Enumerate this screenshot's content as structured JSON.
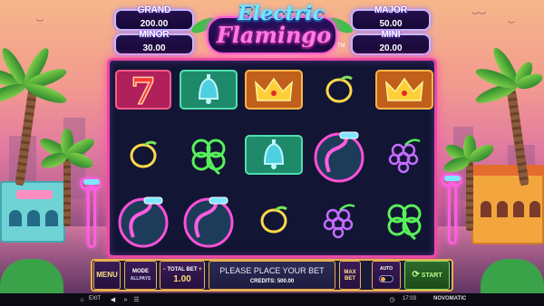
{
  "jackpots": {
    "grand": {
      "label": "GRAND",
      "value": "200.00"
    },
    "minor": {
      "label": "MINOR",
      "value": "30.00"
    },
    "major": {
      "label": "MAJOR",
      "value": "50.00"
    },
    "mini": {
      "label": "MINI",
      "value": "20.00"
    }
  },
  "logo": {
    "line1": "Electric",
    "line2": "Flamingo",
    "tm": "TM"
  },
  "reels": [
    [
      "seven",
      "lemon",
      "flamingo-half"
    ],
    [
      "bell",
      "clover",
      "flamingo-half"
    ],
    [
      "crown",
      "bell",
      "lemon"
    ],
    [
      "lemon",
      "flamingo",
      "grapes"
    ],
    [
      "crown",
      "grapes",
      "clover"
    ]
  ],
  "controls": {
    "menu": "MENU",
    "mode_label": "MODE",
    "mode_value": "ALLPAYS",
    "total_bet_label": "TOTAL BET",
    "total_bet_value": "1.00",
    "message": "PLEASE PLACE YOUR BET",
    "credits": "CREDITS: 500.00",
    "max_bet": "MAX BET",
    "auto": "AUTO",
    "start": "START"
  },
  "status_bar": {
    "exit": "EXIT",
    "time": "17:03",
    "brand": "NOVOMATIC"
  },
  "colors": {
    "accent": "#e94aa0",
    "gold": "#e9b04e",
    "neon_green": "#58f05a",
    "neon_pink": "#ff4fd8"
  }
}
